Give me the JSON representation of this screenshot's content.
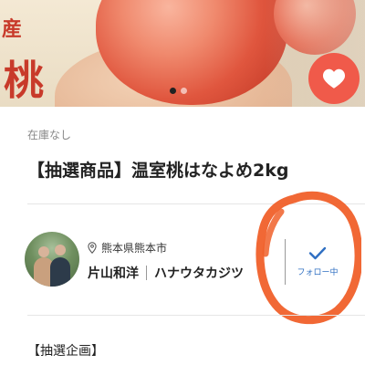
{
  "hero": {
    "box_text_top": "産",
    "box_text_bottom": "桃",
    "carousel_total": 2,
    "carousel_active": 1
  },
  "product": {
    "stock_status": "在庫なし",
    "title": "【抽選商品】温室桃はなよめ2kg"
  },
  "producer": {
    "location": "熊本県熊本市",
    "name": "片山和洋",
    "farm": "ハナウタカジツ",
    "follow_label": "フォロー中"
  },
  "section": {
    "heading": "【抽選企画】"
  },
  "icons": {
    "favorite": "heart-icon",
    "location": "location-pin-icon",
    "follow": "checkmark-icon"
  },
  "colors": {
    "favorite_bg": "#f05a4a",
    "follow_accent": "#2f6fc2",
    "annotation": "#f0602a"
  }
}
